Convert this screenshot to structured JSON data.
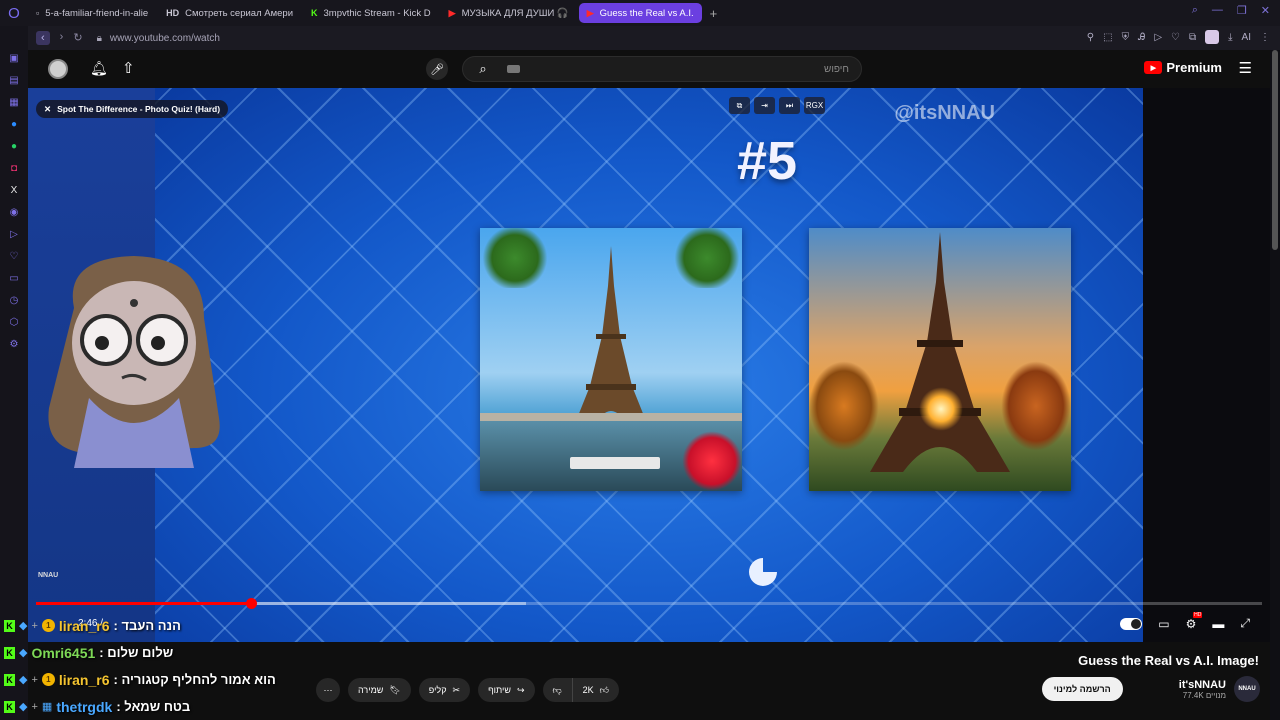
{
  "browser": {
    "tabs": [
      {
        "label": "5-a-familiar-friend-in-alie",
        "favicon": "doc-icon",
        "active": false
      },
      {
        "label": "Смотреть сериал Амери",
        "favicon": "HD",
        "active": false
      },
      {
        "label": "3mpvthic Stream - Kick D",
        "favicon": "K",
        "active": false
      },
      {
        "label": "МУЗЫКА ДЛЯ ДУШИ 🎧",
        "favicon": "▶",
        "active": false
      },
      {
        "label": "Guess the Real vs A.I.",
        "favicon": "▶",
        "active": true
      }
    ],
    "url": "www.youtube.com/watch",
    "new_tab": "+",
    "accent": "#6b3fe0"
  },
  "youtube": {
    "search_placeholder": "חיפוש",
    "premium_label": "Premium"
  },
  "video": {
    "miniplayer_title": "Spot The Difference - Photo Quiz! (Hard)",
    "overlay_badge": "RGX",
    "watermark": "@itsNNAU",
    "big_number": "#5",
    "corner_logo": "NNAU",
    "time_text": "2:46 / ",
    "progress_played": 0.175,
    "progress_buffered": 0.4
  },
  "below": {
    "title": "Guess the Real vs A.I. Image!",
    "channel_name": "it'sNNAU",
    "channel_avatar": "NNAU",
    "subscribers": "77.4K מנויים",
    "subscribe_label": "הרשמה למינוי",
    "like_count": "2K",
    "share_label": "שיתוף",
    "clip_label": "קליפ",
    "save_label": "שמירה",
    "more_label": "⋯"
  },
  "chat": [
    {
      "user": "liran_r6",
      "user_color": "#f4c430",
      "message": "הנה העבד",
      "badge": "1"
    },
    {
      "user": "Omri6451",
      "user_color": "#7ed957",
      "message": "שלום שלום",
      "badge": ""
    },
    {
      "user": "liran_r6",
      "user_color": "#f4c430",
      "message": "הוא אמור להחליף קטגוריה",
      "badge": "1"
    },
    {
      "user": "thetrgdk",
      "user_color": "#4aa8ff",
      "message": "בטח שמאל",
      "badge": ""
    }
  ]
}
